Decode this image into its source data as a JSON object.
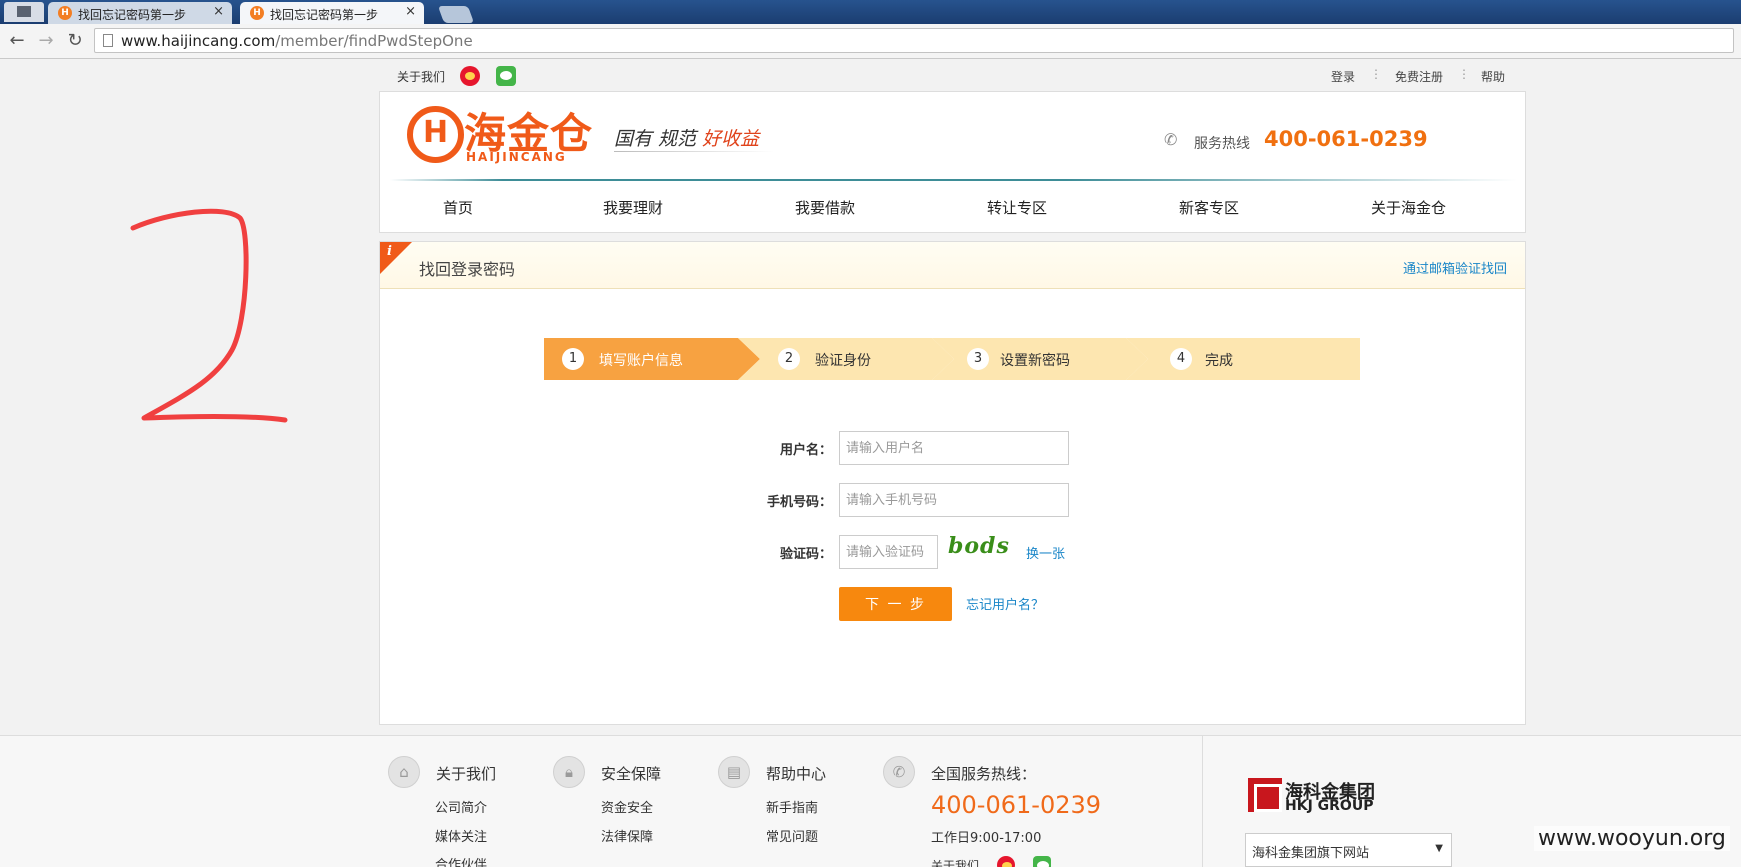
{
  "browser": {
    "tabs": [
      {
        "title": "找回忘记密码第一步",
        "close": "×"
      },
      {
        "title": "找回忘记密码第一步",
        "close": "×"
      }
    ],
    "url_host": "www.haijincang.com",
    "url_path": "/member/findPwdStepOne"
  },
  "topstrip": {
    "about": "关于我们",
    "login": "登录",
    "register": "免费注册",
    "help": "帮助",
    "sep": "⋮"
  },
  "header": {
    "logo_mark": "H",
    "logo_cn": "海金仓",
    "logo_en": "HAIJINCANG",
    "slogan_plain": "国有 规范 ",
    "slogan_highlight": "好收益",
    "hotline_label": "服务热线",
    "hotline_number": "400-061-0239",
    "nav": [
      "首页",
      "我要理财",
      "我要借款",
      "转让专区",
      "新客专区",
      "关于海金仓"
    ]
  },
  "panel": {
    "info_glyph": "i",
    "title": "找回登录密码",
    "email_link": "通过邮箱验证找回",
    "steps": [
      {
        "num": "1",
        "label": "填写账户信息"
      },
      {
        "num": "2",
        "label": "验证身份"
      },
      {
        "num": "3",
        "label": "设置新密码"
      },
      {
        "num": "4",
        "label": "完成"
      }
    ],
    "form": {
      "username_label": "用户名：",
      "username_placeholder": "请输入用户名",
      "phone_label": "手机号码：",
      "phone_placeholder": "请输入手机号码",
      "captcha_label": "验证码：",
      "captcha_placeholder": "请输入验证码",
      "captcha_text": "bods",
      "refresh": "换一张",
      "next": "下 一 步",
      "forgot": "忘记用户名？"
    }
  },
  "footer": {
    "cols": [
      {
        "title": "关于我们",
        "links": [
          "公司简介",
          "媒体关注",
          "合作伙伴"
        ]
      },
      {
        "title": "安全保障",
        "links": [
          "资金安全",
          "法律保障"
        ]
      },
      {
        "title": "帮助中心",
        "links": [
          "新手指南",
          "常见问题"
        ]
      }
    ],
    "hotline_title": "全国服务热线：",
    "hotline_number": "400-061-0239",
    "hours": "工作日9:00-17:00",
    "about": "关于我们",
    "group_cn": "海科金集团",
    "group_en": "HKJ GROUP",
    "group_select": "海科金集团旗下网站"
  },
  "annotation": {
    "scrawl_text": "2"
  },
  "watermark": "www.wooyun.org",
  "colors": {
    "brand_orange": "#f05a19",
    "step_active": "#f7a241",
    "step_inactive": "#fde6b0",
    "link_blue": "#1a86c8",
    "annotation_red": "#f04040"
  }
}
